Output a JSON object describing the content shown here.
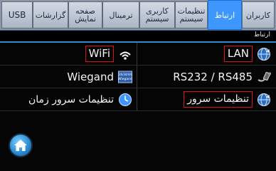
{
  "tabs": [
    {
      "label": "USB"
    },
    {
      "label": "گزارشات"
    },
    {
      "label": "صفحه\nنمایش"
    },
    {
      "label": "ترمینال"
    },
    {
      "label": "کاربری\nسیستم"
    },
    {
      "label": "تنظیمات\nسیستم"
    },
    {
      "label": "ارتباط",
      "active": true
    },
    {
      "label": "کاربران"
    }
  ],
  "section": {
    "title": "ارتباط"
  },
  "items": {
    "lan": "LAN",
    "wifi": "WiFi",
    "rs232": "RS232 / RS485",
    "wiegand": "Wiegand",
    "server_settings": "تنظیمات سرور",
    "time_server": "تنظیمات سرور زمان",
    "wiegand_icon_text": "26/34/44\nWiegand"
  },
  "colors": {
    "accent": "#3d97ff",
    "highlight_box": "#e0101a",
    "background": "#050505"
  },
  "icons": {
    "home": "home-icon",
    "globe": "globe-icon",
    "wifi": "wifi-icon",
    "serial": "serial-cable-icon",
    "wiegand": "wiegand-icon",
    "clock": "clock-icon"
  }
}
